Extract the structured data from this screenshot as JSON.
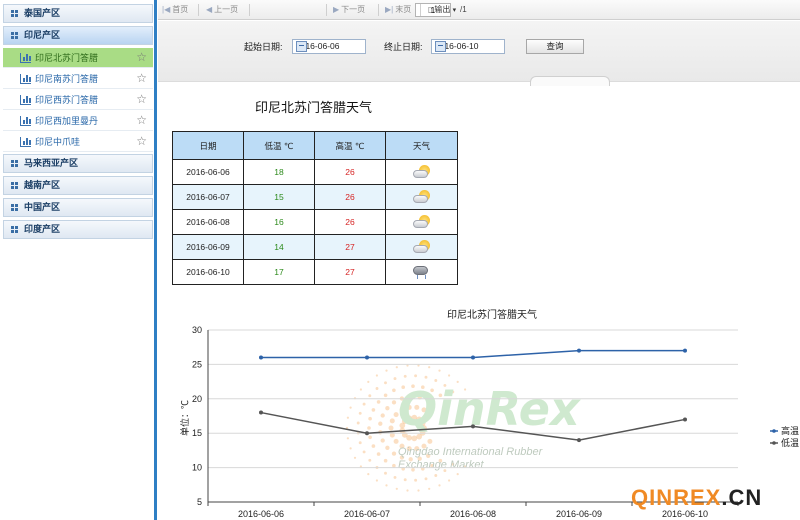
{
  "sidebar": {
    "groups": [
      {
        "label": "泰国产区"
      },
      {
        "label": "印尼产区"
      },
      {
        "label": "马来西亚产区"
      },
      {
        "label": "越南产区"
      },
      {
        "label": "中国产区"
      },
      {
        "label": "印度产区"
      }
    ],
    "sub_items": [
      {
        "label": "印尼北苏门答腊",
        "selected": true
      },
      {
        "label": "印尼南苏门答腊",
        "selected": false
      },
      {
        "label": "印尼西苏门答腊",
        "selected": false
      },
      {
        "label": "印尼西加里曼丹",
        "selected": false
      },
      {
        "label": "印尼中爪哇",
        "selected": false
      }
    ],
    "accent_color": "#2f7fc4",
    "selected_color": "#a9dc85"
  },
  "toolbar": {
    "first": "首页",
    "prev": "上一页",
    "page": "1",
    "total": "/1",
    "next": "下一页",
    "last": "末页",
    "export": "输出"
  },
  "filter": {
    "start_label": "起始日期:",
    "start_value": "2016-06-06",
    "end_label": "终止日期:",
    "end_value": "2016-06-10",
    "query_label": "查询"
  },
  "report": {
    "title": "印尼北苏门答腊天气",
    "columns": [
      "日期",
      "低温 ℃",
      "高温 ℃",
      "天气"
    ],
    "rows": [
      {
        "date": "2016-06-06",
        "low": "18",
        "high": "26",
        "weather": "partly-cloudy-icon"
      },
      {
        "date": "2016-06-07",
        "low": "15",
        "high": "26",
        "weather": "partly-cloudy-icon"
      },
      {
        "date": "2016-06-08",
        "low": "16",
        "high": "26",
        "weather": "partly-cloudy-icon"
      },
      {
        "date": "2016-06-09",
        "low": "14",
        "high": "27",
        "weather": "partly-cloudy-icon"
      },
      {
        "date": "2016-06-10",
        "low": "17",
        "high": "27",
        "weather": "thunderstorm-icon"
      }
    ]
  },
  "chart_data": {
    "type": "line",
    "title": "印尼北苏门答腊天气",
    "ylabel": "单位：℃",
    "categories": [
      "2016-06-06",
      "2016-06-07",
      "2016-06-08",
      "2016-06-09",
      "2016-06-10"
    ],
    "ylim": [
      5,
      30
    ],
    "yticks": [
      5,
      10,
      15,
      20,
      25,
      30
    ],
    "grid": true,
    "legend": "right",
    "series": [
      {
        "name": "高温",
        "values": [
          26,
          26,
          26,
          27,
          27
        ],
        "color": "#2d62a8"
      },
      {
        "name": "低温",
        "values": [
          18,
          15,
          16,
          14,
          17
        ],
        "color": "#555555"
      }
    ]
  },
  "watermark": {
    "brand": "QinRex",
    "tagline1": "Qingdao International Rubber",
    "tagline2": "Exchange Market",
    "site_part1": "QINREX",
    "site_part2": ".CN",
    "colors": {
      "orange": "#f08a24",
      "green": "#3aa64a",
      "dark": "#222222"
    }
  }
}
